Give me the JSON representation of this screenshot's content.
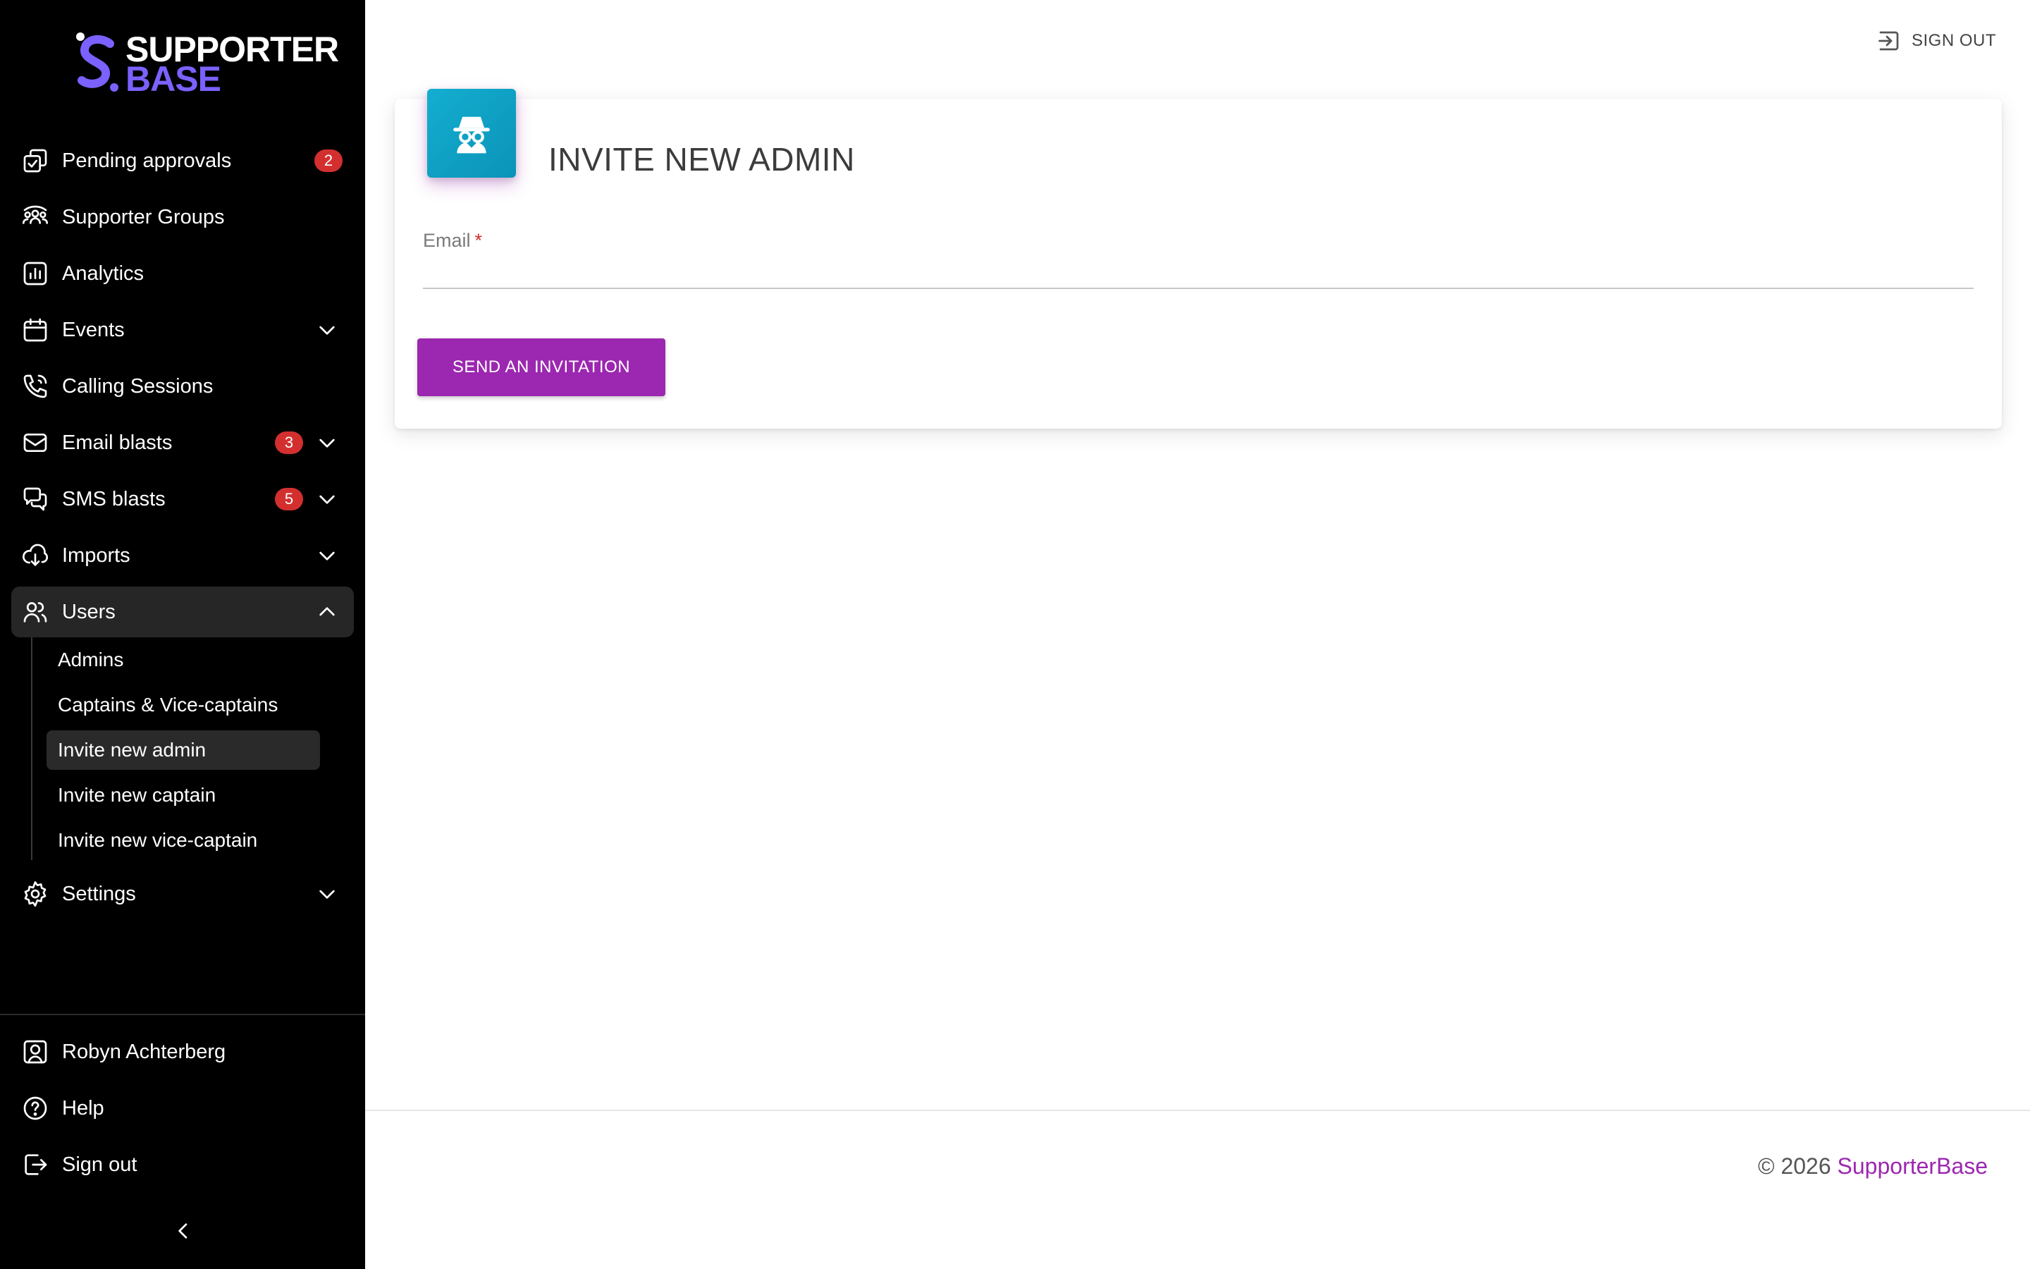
{
  "brand": {
    "logo_line1": "SUPPORTER",
    "logo_line2": "BASE",
    "colors": {
      "sidebar_bg": "#000000",
      "accent_purple": "#9c27b0",
      "logo_purple": "#7b61ff",
      "icon_teal": "#14aed0",
      "badge_red": "#d32f2f"
    }
  },
  "sidebar": {
    "items": [
      {
        "label": "Pending approvals",
        "icon": "approvals-icon",
        "badge": "2"
      },
      {
        "label": "Supporter Groups",
        "icon": "groups-icon"
      },
      {
        "label": "Analytics",
        "icon": "analytics-icon"
      },
      {
        "label": "Events",
        "icon": "calendar-icon",
        "expandable": true
      },
      {
        "label": "Calling Sessions",
        "icon": "phone-icon"
      },
      {
        "label": "Email blasts",
        "icon": "mail-icon",
        "badge": "3",
        "expandable": true
      },
      {
        "label": "SMS blasts",
        "icon": "chat-icon",
        "badge": "5",
        "expandable": true
      },
      {
        "label": "Imports",
        "icon": "cloud-download-icon",
        "expandable": true
      },
      {
        "label": "Users",
        "icon": "users-icon",
        "expandable": true,
        "expanded": true,
        "active": true
      },
      {
        "label": "Settings",
        "icon": "gear-icon",
        "expandable": true
      }
    ],
    "users_sub": [
      {
        "label": "Admins"
      },
      {
        "label": "Captains & Vice-captains"
      },
      {
        "label": "Invite new admin",
        "active": true
      },
      {
        "label": "Invite new captain"
      },
      {
        "label": "Invite new vice-captain"
      }
    ],
    "bottom": [
      {
        "label": "Robyn Achterberg",
        "icon": "user-icon"
      },
      {
        "label": "Help",
        "icon": "help-icon"
      },
      {
        "label": "Sign out",
        "icon": "logout-icon"
      }
    ]
  },
  "header": {
    "signout_label": "SIGN OUT"
  },
  "card": {
    "title": "INVITE NEW ADMIN",
    "icon": "incognito-icon",
    "email_label": "Email",
    "required_mark": "*",
    "email_value": "",
    "send_label": "SEND AN INVITATION"
  },
  "footer": {
    "copyright": "© 2026",
    "brand_link": "SupporterBase"
  }
}
